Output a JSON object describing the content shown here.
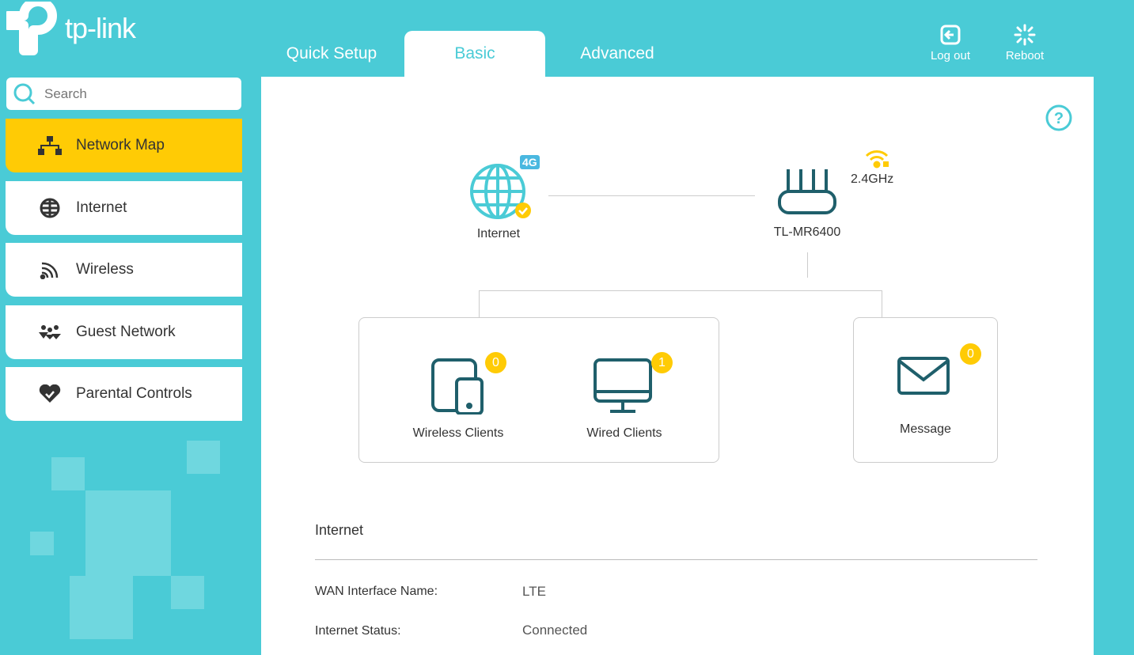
{
  "brand": "tp-link",
  "tabs": [
    {
      "label": "Quick Setup"
    },
    {
      "label": "Basic"
    },
    {
      "label": "Advanced"
    }
  ],
  "toolbar": {
    "logout": "Log out",
    "reboot": "Reboot"
  },
  "search": {
    "placeholder": "Search"
  },
  "sidebar": {
    "items": [
      {
        "label": "Network Map"
      },
      {
        "label": "Internet"
      },
      {
        "label": "Wireless"
      },
      {
        "label": "Guest Network"
      },
      {
        "label": "Parental Controls"
      }
    ]
  },
  "map": {
    "internet_label": "Internet",
    "internet_badge": "4G",
    "router_label": "TL-MR6400",
    "band": "2.4GHz",
    "wireless_clients": {
      "label": "Wireless Clients",
      "count": "0"
    },
    "wired_clients": {
      "label": "Wired Clients",
      "count": "1"
    },
    "message": {
      "label": "Message",
      "count": "0"
    }
  },
  "internet": {
    "title": "Internet",
    "rows": [
      {
        "label": "WAN Interface Name:",
        "value": "LTE"
      },
      {
        "label": "Internet Status:",
        "value": "Connected"
      }
    ]
  },
  "colors": {
    "accent": "#4acbd6",
    "active": "#ffcb05",
    "icon": "#1f5f6b"
  }
}
